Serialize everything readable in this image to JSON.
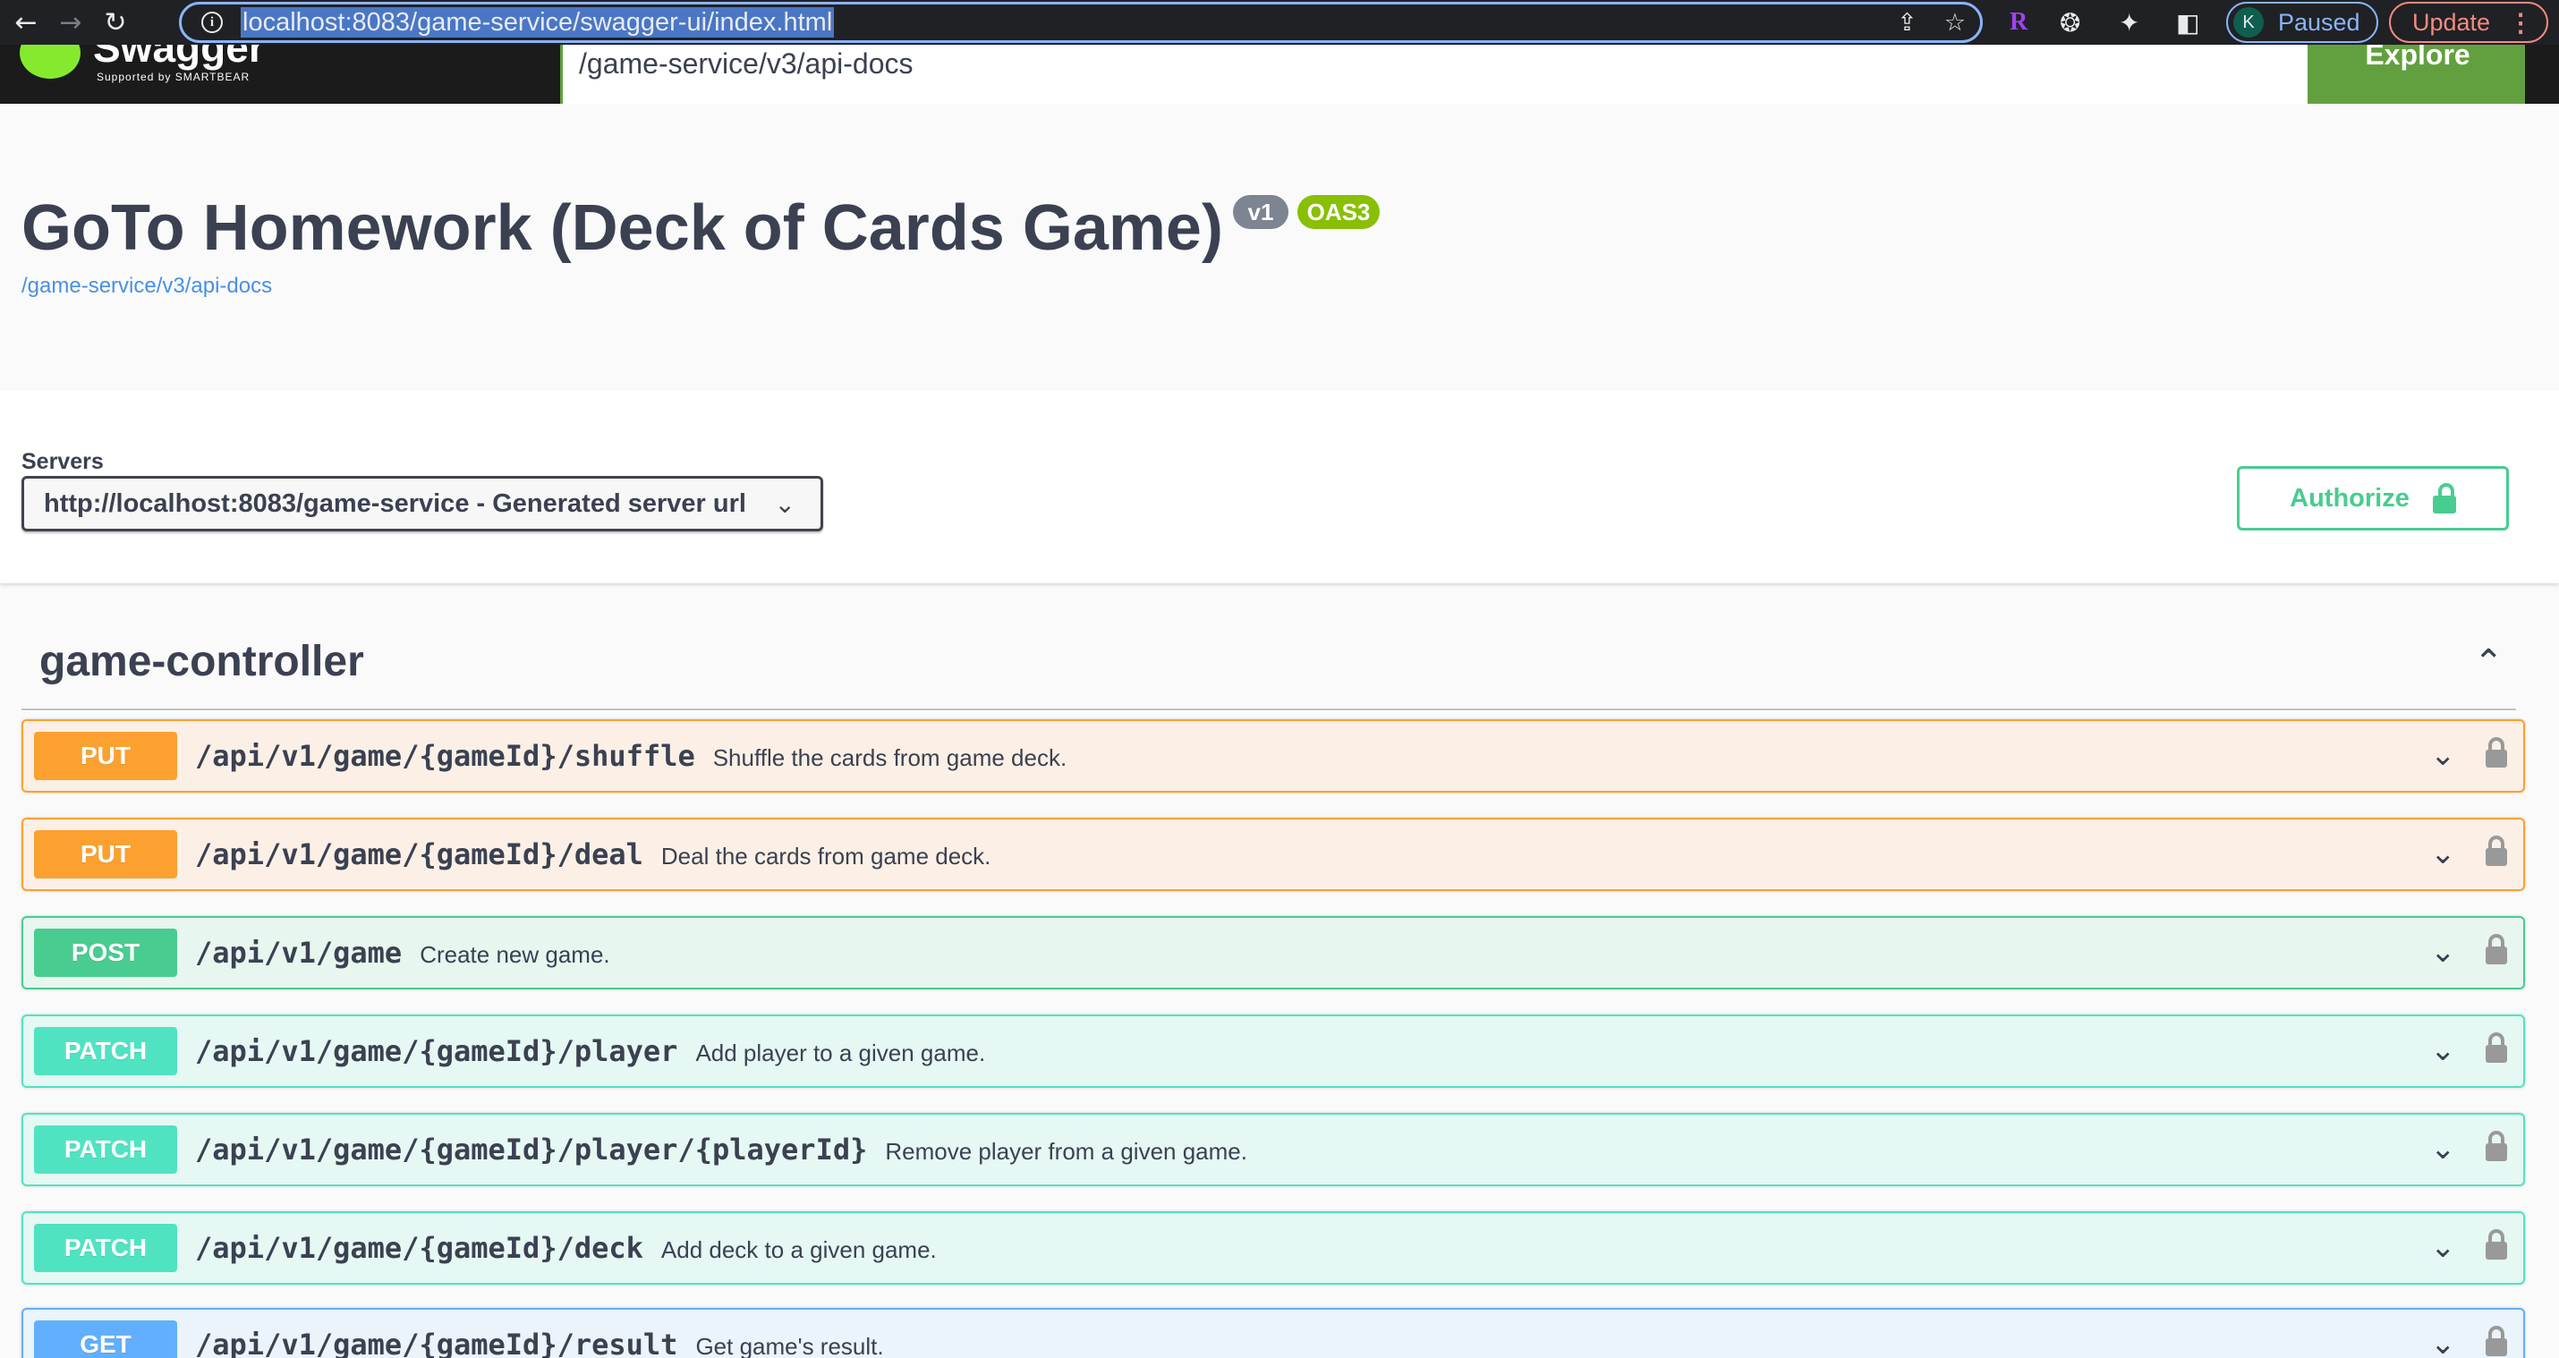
{
  "browser": {
    "url": "localhost:8083/game-service/swagger-ui/index.html",
    "profile_initial": "K",
    "profile_status": "Paused",
    "update_label": "Update",
    "extension_r": "R"
  },
  "topbar": {
    "logo_text": "Swagger",
    "logo_sub": "Supported by SMARTBEAR",
    "spec_url": "/game-service/v3/api-docs",
    "explore_label": "Explore"
  },
  "info": {
    "title": "GoTo Homework (Deck of Cards Game)",
    "version_badge": "v1",
    "oas_badge": "OAS3",
    "api_docs_link": "/game-service/v3/api-docs"
  },
  "servers": {
    "label": "Servers",
    "selected": "http://localhost:8083/game-service - Generated server url"
  },
  "authorize_label": "Authorize",
  "tag": {
    "name": "game-controller"
  },
  "operations": [
    {
      "method": "PUT",
      "path": "/api/v1/game/{gameId}/shuffle",
      "summary": "Shuffle the cards from game deck."
    },
    {
      "method": "PUT",
      "path": "/api/v1/game/{gameId}/deal",
      "summary": "Deal the cards from game deck."
    },
    {
      "method": "POST",
      "path": "/api/v1/game",
      "summary": "Create new game."
    },
    {
      "method": "PATCH",
      "path": "/api/v1/game/{gameId}/player",
      "summary": "Add player to a given game."
    },
    {
      "method": "PATCH",
      "path": "/api/v1/game/{gameId}/player/{playerId}",
      "summary": "Remove player from a given game."
    },
    {
      "method": "PATCH",
      "path": "/api/v1/game/{gameId}/deck",
      "summary": "Add deck to a given game."
    },
    {
      "method": "GET",
      "path": "/api/v1/game/{gameId}/result",
      "summary": "Get game's result."
    }
  ],
  "colors": {
    "put": "#fca130",
    "post": "#49cc90",
    "patch": "#50e3c2",
    "get": "#61affe",
    "authorize": "#49cc90"
  }
}
